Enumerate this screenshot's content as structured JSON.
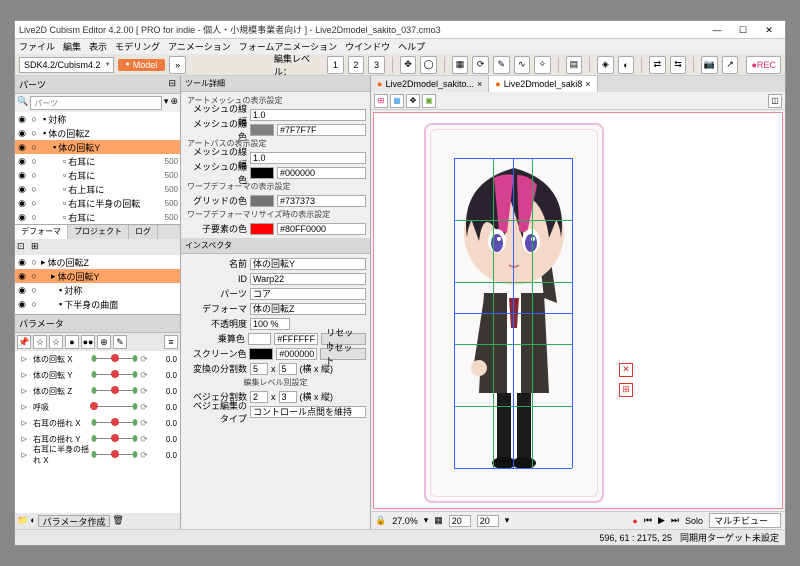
{
  "title": "Live2D Cubism Editor 4.2.00   [ PRO for indie - 個人・小規模事業者向け ]  - Live2Dmodel_sakito_037.cmo3",
  "menu": [
    "ファイル",
    "編集",
    "表示",
    "モデリング",
    "アニメーション",
    "フォームアニメーション",
    "ウインドウ",
    "ヘルプ"
  ],
  "toolbar": {
    "sdk": "SDK4.2/Cubism4.2",
    "mode": "Model",
    "edit_lvl_lbl": "編集レベル：",
    "edit_lvl": "1"
  },
  "parts": {
    "head": "パーツ",
    "items": [
      {
        "n": "対称",
        "i": 0
      },
      {
        "n": "体の回転Z",
        "i": 0
      },
      {
        "n": "体の回転Y",
        "i": 1,
        "sel": true
      },
      {
        "n": "右耳に",
        "i": 2,
        "v": "500"
      },
      {
        "n": "右耳に",
        "i": 2,
        "v": "500"
      },
      {
        "n": "右上耳に",
        "i": 2,
        "v": "500"
      },
      {
        "n": "右耳に半身の回転",
        "i": 2,
        "v": "500"
      },
      {
        "n": "右耳に",
        "i": 2,
        "v": "500"
      }
    ]
  },
  "deformer": {
    "tabs": [
      "デフォーマ",
      "プロジェクト",
      "ログ"
    ],
    "items": [
      {
        "n": "体の回転Z",
        "i": 0
      },
      {
        "n": "体の回転Y",
        "i": 1,
        "sel": true
      },
      {
        "n": "対称",
        "i": 2
      },
      {
        "n": "下半身の曲面",
        "i": 2
      }
    ]
  },
  "tool_detail": {
    "head": "ツール詳細",
    "sub1": "アートメッシュの表示設定",
    "mesh_line_lbl": "メッシュの線幅",
    "mesh_line_val": "1.0",
    "mesh_color_lbl": "メッシュの線色",
    "mesh_color_val": "#7F7F7F",
    "sub2": "アートパスの表示設定",
    "path_line_lbl": "メッシュの線幅",
    "path_line_val": "1.0",
    "path_color_lbl": "メッシュの線色",
    "path_color_val": "#000000",
    "sub3": "ワープデフォーマの表示設定",
    "grid_color_lbl": "グリッドの色",
    "grid_color_val": "#737373",
    "sub4": "ワープデフォーマリサイズ時の表示設定",
    "child_color_lbl": "子要素の色",
    "child_color_val": "#80FF0000"
  },
  "inspector": {
    "head": "インスペクタ",
    "name_lbl": "名前",
    "name_val": "体の回転Y",
    "id_lbl": "ID",
    "id_val": "Warp22",
    "parts_lbl": "パーツ",
    "parts_val": "コア",
    "def_lbl": "デフォーマ",
    "def_val": "体の回転Z",
    "opacity_lbl": "不透明度",
    "opacity_val": "100 %",
    "mult_lbl": "乗算色",
    "mult_val": "#FFFFFF",
    "reset": "リセット",
    "scr_lbl": "スクリーン色",
    "scr_val": "#000000",
    "conv_lbl": "変換の分割数",
    "conv_a": "5",
    "conv_b": "5",
    "conv_x": "(横 x 縦)",
    "sub_edit": "編集レベル別設定",
    "bez_lbl": "ベジェ分割数",
    "bez_a": "2",
    "bez_b": "3",
    "bez_x": "(横 x 縦)",
    "bez_type_lbl": "ベジェ編集のタイプ",
    "bez_type_val": "コントロール点間を維持"
  },
  "params": {
    "head": "パラメータ",
    "bottom_btn": "パラメータ作成",
    "rows": [
      {
        "n": "体の回転  X",
        "v": "0.0"
      },
      {
        "n": "体の回転  Y",
        "v": "0.0"
      },
      {
        "n": "体の回転  Z",
        "v": "0.0"
      },
      {
        "n": "呼吸",
        "v": "0.0",
        "pos": 0
      },
      {
        "n": "右耳の揺れ  X",
        "v": "0.0"
      },
      {
        "n": "右耳の揺れ  Y",
        "v": "0.0"
      },
      {
        "n": "右耳に半身の揺れ  X",
        "v": "0.0"
      }
    ]
  },
  "canvas": {
    "tabs": [
      {
        "n": "Live2Dmodel_sakito...",
        "on": false
      },
      {
        "n": "Live2Dmodel_saki8",
        "on": true
      }
    ],
    "zoom": "27.0%",
    "gridw": "20",
    "gridh": "20",
    "solo_lbl": "Solo",
    "multi": "マルチビュー"
  },
  "status": {
    "coord": "596, 61 : 2175, 25",
    "sync": "同期用ターゲット未設定"
  }
}
